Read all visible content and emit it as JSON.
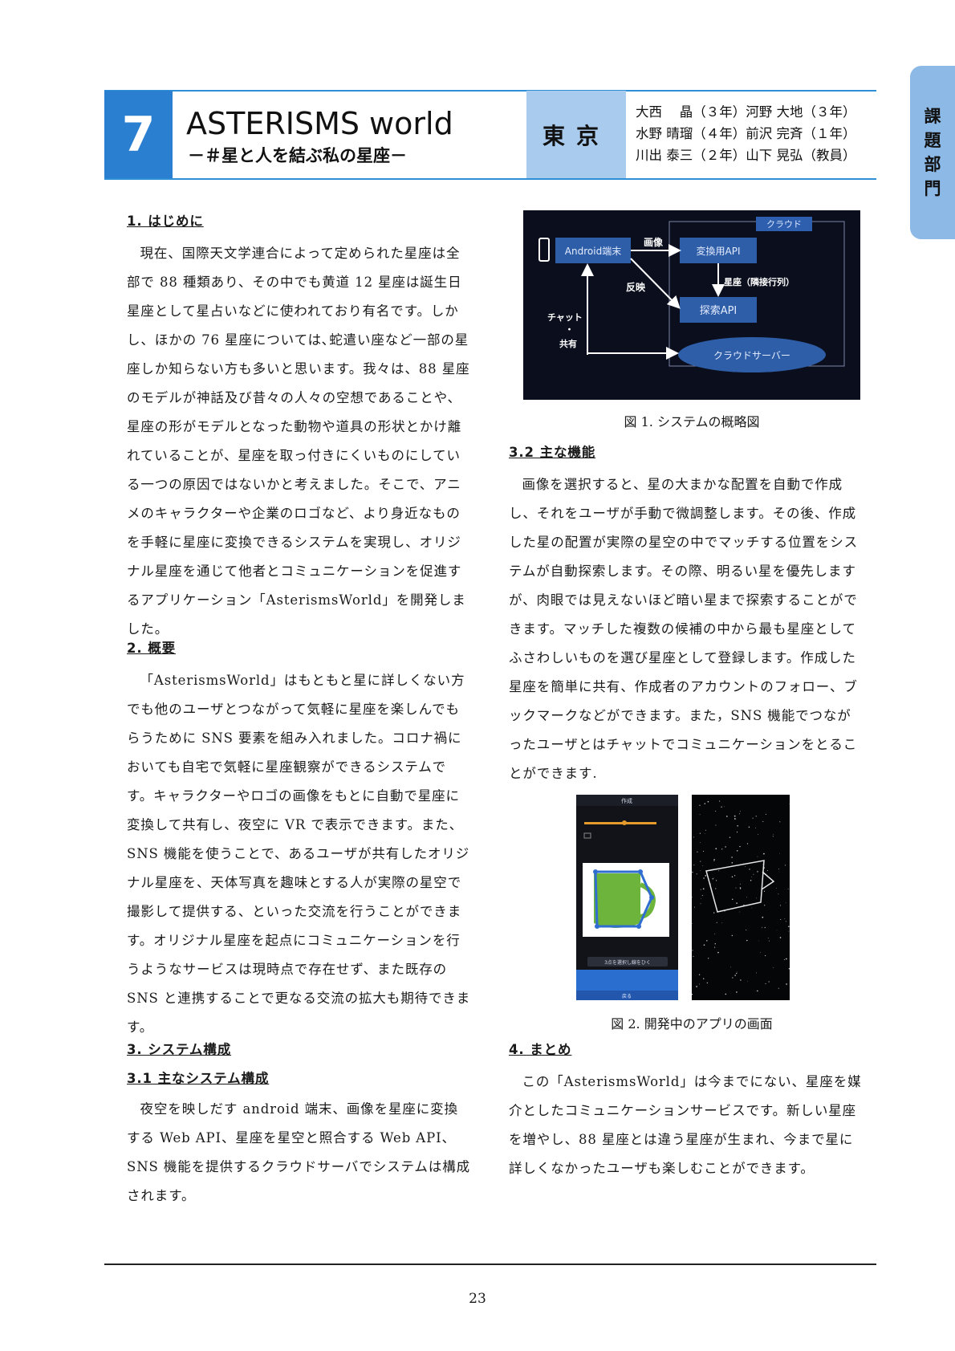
{
  "header": {
    "number": "7",
    "title": "ASTERISMS world",
    "subtitle": "－＃星と人を結ぶ私の星座－",
    "location": "東京",
    "members": "大西　 晶（３年）河野 大地（３年）\n水野 晴瑠（４年）前沢 完斉（１年）\n川出 泰三（２年）山下 晃弘（教員）",
    "side_tab": [
      "課",
      "題",
      "部",
      "門"
    ]
  },
  "left": {
    "s1_heading": "1. はじめに",
    "s1_body": "現在、国際天文学連合によって定められた星座は全部で 88 種類あり、その中でも黄道 12 星座は誕生日星座として星占いなどに使われており有名です。しかし、ほかの 76 星座については､蛇遣い座など一部の星座しか知らない方も多いと思います。我々は、88 星座のモデルが神話及び昔々の人々の空想であることや、星座の形がモデルとなった動物や道具の形状とかけ離れていることが、星座を取っ付きにくいものにしている一つの原因ではないかと考えました。そこで、アニメのキャラクターや企業のロゴなど、より身近なものを手軽に星座に変換できるシステムを実現し、オリジナル星座を通じて他者とコミュニケーションを促進するアプリケーション「AsterismsWorld」を開発しました。",
    "s2_heading": "2. 概要",
    "s2_body": "「AsterismsWorld」はもともと星に詳しくない方でも他のユーザとつながって気軽に星座を楽しんでもらうために SNS 要素を組み入れました。コロナ禍においても自宅で気軽に星座観察ができるシステムです。キャラクターやロゴの画像をもとに自動で星座に変換して共有し、夜空に VR で表示できます。また、SNS 機能を使うことで、あるユーザが共有したオリジナル星座を、天体写真を趣味とする人が実際の星空で撮影して提供する、といった交流を行うことができます。オリジナル星座を起点にコミュニケーションを行うようなサービスは現時点で存在せず、また既存の SNS と連携することで更なる交流の拡大も期待できます。",
    "s3_heading": "3. システム構成",
    "s31_heading": "3.1 主なシステム構成",
    "s31_body": "夜空を映しだす android 端末、画像を星座に変換する Web API、星座を星空と照合する Web API、SNS 機能を提供するクラウドサーバでシステムは構成されます。"
  },
  "right": {
    "fig1": {
      "cloud": "クラウド",
      "android": "Android端末",
      "image": "画像",
      "convert_api": "変換用API",
      "constellation": "星座（隣接行列）",
      "reflect": "反映",
      "search_api": "探索API",
      "chat": "チャット",
      "dot": "・",
      "share": "共有",
      "cloud_server": "クラウドサーバー"
    },
    "fig1_caption": "図 1. システムの概略図",
    "s32_heading": "3.2 主な機能",
    "s32_body": "画像を選択すると、星の大まかな配置を自動で作成し、それをユーザが手動で微調整します。その後、作成した星の配置が実際の星空の中でマッチする位置をシステムが自動探索します。その際、明るい星を優先しますが、肉眼では見えないほど暗い星まで探索することができます。マッチした複数の候補の中から最も星座としてふさわしいものを選び星座として登録します。作成した星座を簡単に共有、作成者のアカウントのフォロー、ブックマークなどができます。また，SNS 機能でつながったユーザとはチャットでコミュニケーションをとることができます.",
    "fig2": {
      "screen_title": "作成",
      "select_button": "3点を選択し線をひく",
      "nav_label": "戻る"
    },
    "fig2_caption": "図 2. 開発中のアプリの画面",
    "s4_heading": "4. まとめ",
    "s4_body": "この「AsterismsWorld」は今までにない、星座を媒介としたコミュニケーションサービスです。新しい星座を増やし、88 星座とは違う星座が生まれ、今まで星に詳しくなかったユーザも楽しむことができます。"
  },
  "footer": {
    "page": "23"
  },
  "colors": {
    "accent": "#2a7fd0",
    "location_bg": "#a9ccee",
    "tab_bg": "#8db9e6"
  }
}
